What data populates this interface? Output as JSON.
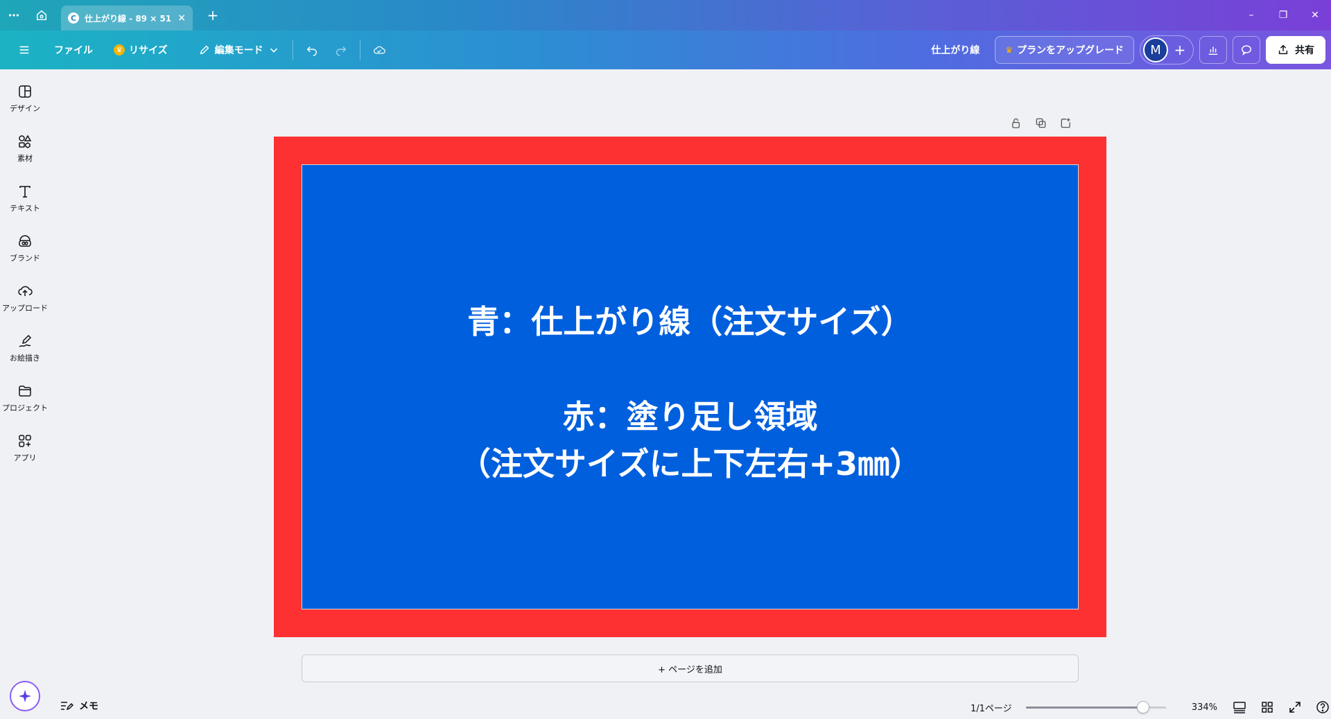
{
  "browser": {
    "tab_title": "仕上がり線 - 89 × 51...",
    "tab_favicon": "C",
    "tab_close": "×",
    "new_tab": "+"
  },
  "window_controls": {
    "minimize": "–",
    "restore": "❐",
    "close": "✕"
  },
  "toolbar": {
    "file_label": "ファイル",
    "resize_label": "リサイズ",
    "edit_mode_label": "編集モード",
    "doc_title": "仕上がり線",
    "upgrade_label": "プランをアップグレード",
    "avatar_initial": "M",
    "avatar_add": "+",
    "share_label": "共有"
  },
  "sidebar": {
    "items": [
      {
        "label": "デザイン",
        "icon": "design-layout-icon"
      },
      {
        "label": "素材",
        "icon": "elements-icon"
      },
      {
        "label": "テキスト",
        "icon": "text-icon"
      },
      {
        "label": "ブランド",
        "icon": "brand-icon"
      },
      {
        "label": "アップロード",
        "icon": "upload-cloud-icon"
      },
      {
        "label": "お絵描き",
        "icon": "draw-pen-icon"
      },
      {
        "label": "プロジェクト",
        "icon": "folder-icon"
      },
      {
        "label": "アプリ",
        "icon": "apps-icon"
      }
    ]
  },
  "canvas": {
    "line1": "青：仕上がり線（注文サイズ）",
    "line2": "赤：塗り足し領域",
    "line3": "（注文サイズに上下左右+3㎜）",
    "bleed_color": "#fd3131",
    "trim_color": "#005fdd"
  },
  "add_page_label": "+ ページを追加",
  "footer": {
    "memo_label": "メモ",
    "pages_label": "1/1ページ",
    "zoom_value": "334%",
    "zoom_fraction": 0.87
  }
}
